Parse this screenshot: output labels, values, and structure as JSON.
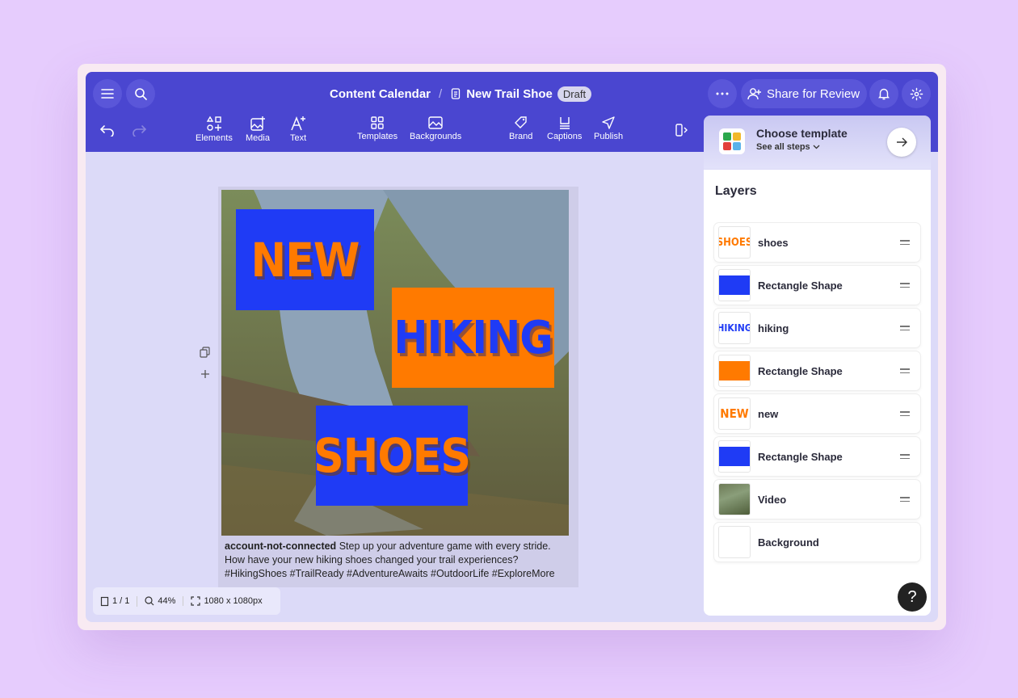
{
  "breadcrumb": {
    "parent": "Content Calendar",
    "current": "New Trail Shoe",
    "status": "Draft"
  },
  "header": {
    "share_label": "Share for Review"
  },
  "toolbar": {
    "elements": "Elements",
    "media": "Media",
    "text": "Text",
    "templates": "Templates",
    "backgrounds": "Backgrounds",
    "brand": "Brand",
    "captions": "Captions",
    "publish": "Publish"
  },
  "template_card": {
    "title": "Choose template",
    "subtitle": "See all steps"
  },
  "layers": {
    "title": "Layers",
    "items": [
      {
        "name": "shoes",
        "thumb": "SHOES"
      },
      {
        "name": "Rectangle Shape"
      },
      {
        "name": "hiking",
        "thumb": "HIKING"
      },
      {
        "name": "Rectangle Shape"
      },
      {
        "name": "new",
        "thumb": "NEW"
      },
      {
        "name": "Rectangle Shape"
      },
      {
        "name": "Video"
      },
      {
        "name": "Background"
      }
    ]
  },
  "artboard": {
    "word1": "NEW",
    "word2": "HIKING",
    "word3": "SHOES"
  },
  "post": {
    "account": "account-not-connected",
    "text": "Step up your adventure game with every stride. How have your new hiking shoes changed your trail experiences? #HikingShoes #TrailReady #AdventureAwaits #OutdoorLife #ExploreMore"
  },
  "status_bar": {
    "pages": "1 / 1",
    "zoom": "44%",
    "size": "1080 x 1080px"
  },
  "help_label": "?",
  "colors": {
    "brand_blue": "#1f3bf5",
    "brand_orange": "#ff7a00",
    "header": "#4a46d0"
  }
}
